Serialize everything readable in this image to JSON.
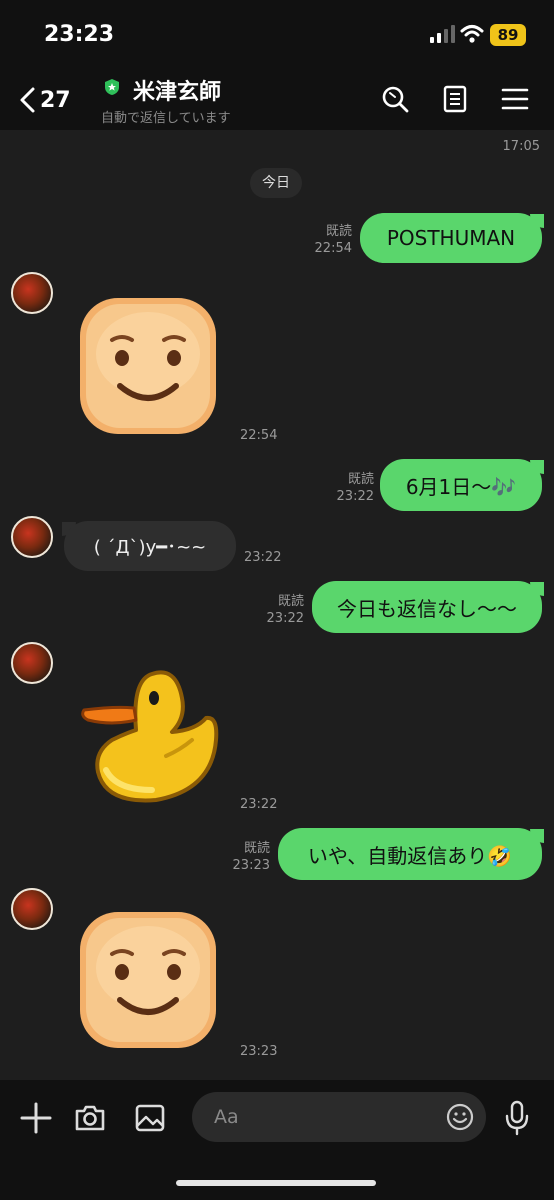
{
  "status_bar": {
    "time": "23:23",
    "battery": "89"
  },
  "header": {
    "back_count": "27",
    "title": "米津玄師",
    "subtitle": "自動で返信しています",
    "icons": [
      "search-icon",
      "notes-icon",
      "menu-icon"
    ]
  },
  "chat": {
    "top_time": "17:05",
    "date_chip": "今日",
    "messages": [
      {
        "side": "out",
        "text": "POSTHUMAN",
        "read": "既読",
        "time": "22:54"
      },
      {
        "side": "in",
        "sticker": "smile-face-sticker",
        "time": "22:54"
      },
      {
        "side": "out",
        "text": "6月1日〜🎶",
        "read": "既読",
        "time": "23:22"
      },
      {
        "side": "in",
        "text": "( ´Д`)y━･~~",
        "time": "23:22"
      },
      {
        "side": "out",
        "text": "今日も返信なし〜〜",
        "read": "既読",
        "time": "23:22"
      },
      {
        "side": "in",
        "sticker": "duck-sticker",
        "time": "23:22"
      },
      {
        "side": "out",
        "text": "いや、自動返信あり🤣",
        "read": "既読",
        "time": "23:23"
      },
      {
        "side": "in",
        "sticker": "smile-face-sticker",
        "time": "23:23"
      }
    ]
  },
  "input": {
    "placeholder": "Aa"
  },
  "colors": {
    "bubble_out": "#5ad66c",
    "bubble_in": "#2e2e2e",
    "bg": "#1e1e1e",
    "bar": "#111111"
  }
}
